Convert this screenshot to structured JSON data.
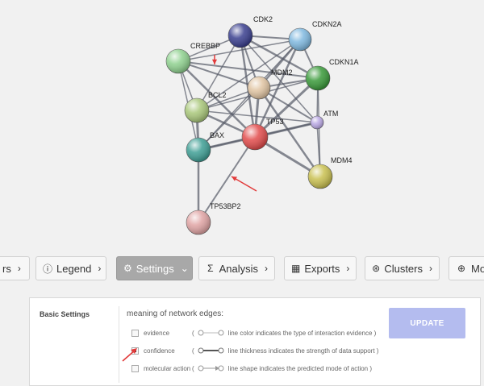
{
  "network": {
    "nodes": [
      {
        "id": "CDK2",
        "color": "#3a3f8f"
      },
      {
        "id": "CDKN2A",
        "color": "#7fb8df"
      },
      {
        "id": "CREBBP",
        "color": "#8fd18f"
      },
      {
        "id": "CDKN1A",
        "color": "#3a9a3a"
      },
      {
        "id": "MDM2",
        "color": "#e0c4a2"
      },
      {
        "id": "BCL2",
        "color": "#a9c77a"
      },
      {
        "id": "ATM",
        "color": "#b9a7e3"
      },
      {
        "id": "TP53",
        "color": "#e24c4c"
      },
      {
        "id": "BAX",
        "color": "#3f9f95"
      },
      {
        "id": "MDM4",
        "color": "#c9c050"
      },
      {
        "id": "TP53BP2",
        "color": "#e0a4a4"
      }
    ]
  },
  "toolbar": {
    "items": [
      {
        "label": "rs",
        "icon": "chevron-right-icon"
      },
      {
        "label": "Legend",
        "icon": "info-icon"
      },
      {
        "label": "Settings",
        "icon": "gear-icon"
      },
      {
        "label": "Analysis",
        "icon": "sigma-icon"
      },
      {
        "label": "Exports",
        "icon": "table-icon"
      },
      {
        "label": "Clusters",
        "icon": "cluster-icon"
      },
      {
        "label": "Mor",
        "icon": "plus-circle-icon"
      }
    ]
  },
  "settings": {
    "section_title": "Basic Settings",
    "edges_heading": "meaning of network edges:",
    "edge_options": [
      {
        "label": "evidence",
        "description": "line color indicates the type of interaction evidence",
        "checked": false
      },
      {
        "label": "confidence",
        "description": "line thickness indicates the strength of data support",
        "checked": true
      },
      {
        "label": "molecular action",
        "description": "line shape indicates the predicted mode of action",
        "checked": false
      }
    ],
    "update_label": "UPDATE"
  },
  "colors": {
    "accent_arrow": "#e23b3b",
    "update_button": "#b4bcef"
  }
}
